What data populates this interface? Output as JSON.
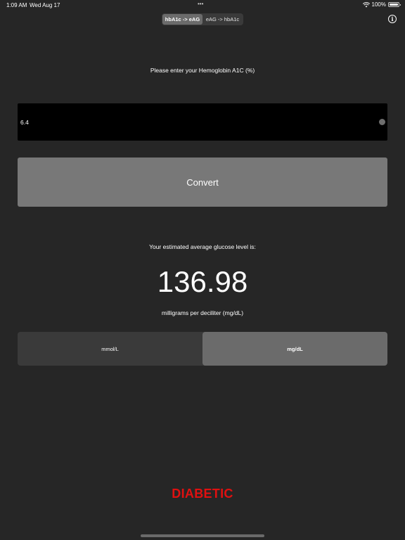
{
  "status_bar": {
    "time": "1:09 AM",
    "date": "Wed Aug 17",
    "dots": "•••",
    "battery": "100%"
  },
  "mode_switch": {
    "options": [
      "hbA1c -> eAG",
      "eAG -> hbA1c"
    ],
    "selected": "hbA1c -> eAG"
  },
  "info_icon": "i",
  "prompt": "Please enter your Hemoglobin A1C (%)",
  "input": {
    "value": "6.4",
    "placeholder": ""
  },
  "convert_label": "Convert",
  "result": {
    "label": "Your estimated average glucose level is:",
    "value": "136.98",
    "unit": "milligrams per deciliter (mg/dL)"
  },
  "unit_toggle": {
    "options": [
      "mmol/L",
      "mg/dL"
    ],
    "selected": "mg/dL"
  },
  "brand": "DIABETIC",
  "colors": {
    "background": "#262626",
    "brand_red": "#e01010",
    "button_gray": "#787878",
    "segment_active": "#6b6b6b"
  }
}
